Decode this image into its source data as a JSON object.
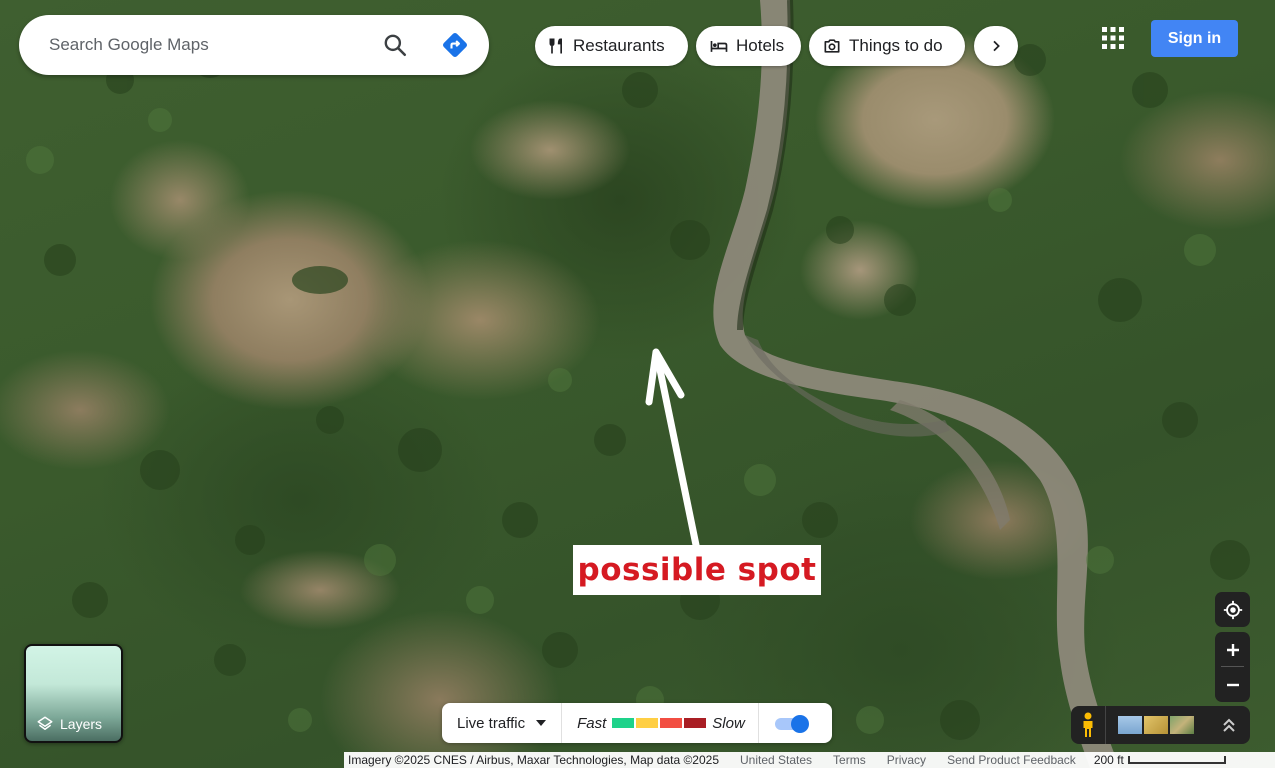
{
  "search": {
    "placeholder": "Search Google Maps"
  },
  "categories": [
    {
      "label": "Restaurants",
      "icon": "restaurant-icon"
    },
    {
      "label": "Hotels",
      "icon": "hotel-icon"
    },
    {
      "label": "Things to do",
      "icon": "camera-icon"
    }
  ],
  "header": {
    "sign_in_label": "Sign in"
  },
  "annotation": {
    "label": "possible spot",
    "color": "#d51a22"
  },
  "layers": {
    "label": "Layers"
  },
  "traffic": {
    "dropdown_label": "Live traffic",
    "fast_label": "Fast",
    "slow_label": "Slow",
    "legend_colors": [
      "#1ed28a",
      "#ffcf44",
      "#f24e42",
      "#a91e24"
    ],
    "toggle_on": true
  },
  "footer": {
    "attribution": "Imagery ©2025 CNES / Airbus, Maxar Technologies, Map data ©2025",
    "region": "United States",
    "terms": "Terms",
    "privacy": "Privacy",
    "feedback": "Send Product Feedback",
    "scale_label": "200 ft"
  },
  "colors": {
    "accent": "#4285f4",
    "directions": "#1a73e8"
  }
}
